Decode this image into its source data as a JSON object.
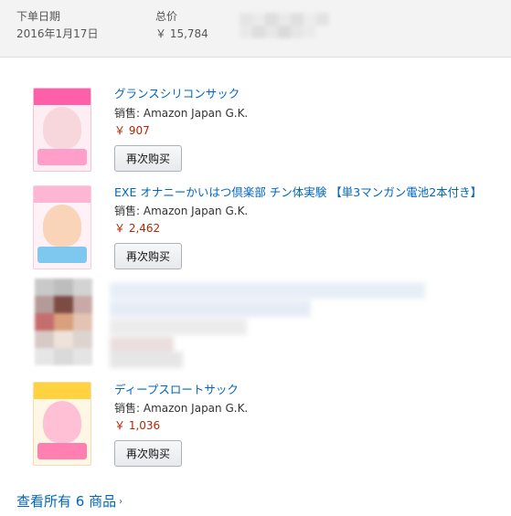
{
  "order": {
    "date_label": "下单日期",
    "date_value": "2016年1月17日",
    "total_label": "总价",
    "total_value": "￥ 15,784"
  },
  "items": [
    {
      "title": "グランスシリコンサック",
      "seller": "销售: Amazon Japan G.K.",
      "price": "￥ 907",
      "button": "再次购买",
      "thumb_colors": [
        "#ff5fa8",
        "#f7d6dc",
        "#ff9ec8"
      ]
    },
    {
      "title": "EXE オナニーかいはつ倶楽部 チン体実験 【単3マンガン電池2本付き】",
      "seller": "销售: Amazon Japan G.K.",
      "price": "￥ 2,462",
      "button": "再次购买",
      "thumb_colors": [
        "#ffb6d5",
        "#f9d4b8",
        "#7ec8ef"
      ]
    },
    {
      "title": "ディープスロートサック",
      "seller": "销售: Amazon Japan G.K.",
      "price": "￥ 1,036",
      "button": "再次购买",
      "thumb_colors": [
        "#ffd23f",
        "#ffc0d6",
        "#ff7fb0"
      ]
    }
  ],
  "footer": {
    "view_all": "查看所有 6 商品",
    "chevron": "›"
  },
  "colors": {
    "link": "#0066c0",
    "price": "#b12704",
    "header_bg": "#f3f3f3"
  }
}
